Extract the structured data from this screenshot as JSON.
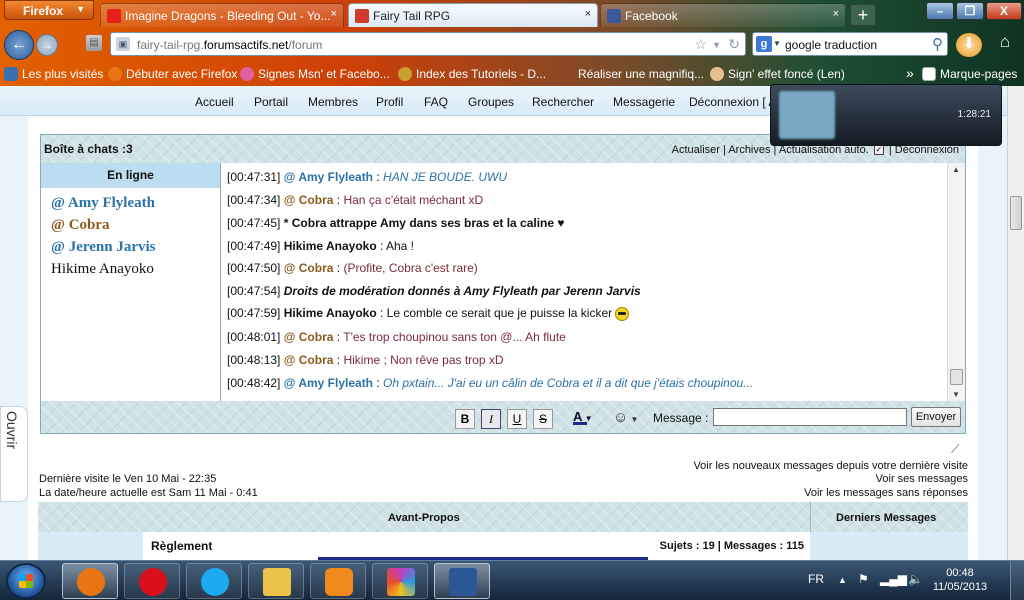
{
  "browser": {
    "menu_label": "Firefox",
    "tabs": [
      {
        "label": "Imagine Dragons - Bleeding Out - Yo...",
        "icon": "youtube-icon",
        "color": "#e62117"
      },
      {
        "label": "Fairy Tail RPG",
        "icon": "fairy-tail-icon",
        "color": "#d03a2a"
      },
      {
        "label": "Facebook",
        "icon": "facebook-icon",
        "color": "#3b5998"
      }
    ],
    "new_tab": "+",
    "window_buttons": {
      "minimize": "–",
      "maximize": "❐",
      "close": "X"
    },
    "url_host_prefix": "fairy-tail-rpg.",
    "url_host_bold": "forumsactifs.net",
    "url_path": "/forum",
    "search_value": "google traduction",
    "search_engine_icon": "google-icon",
    "bookmarks": [
      {
        "label": "Les plus visités",
        "icon": "star-icon",
        "color": "#3a6fb0"
      },
      {
        "label": "Débuter avec Firefox",
        "icon": "firefox-icon",
        "color": "#e87511"
      },
      {
        "label": "Signes Msn' et Facebo...",
        "icon": "flower-icon",
        "color": "#e35f9f"
      },
      {
        "label": "Index des Tutoriels - D...",
        "icon": "bird-icon",
        "color": "#c9a02f"
      },
      {
        "label": "Réaliser une magnifiq...",
        "icon": "blank-icon",
        "color": "#6f8d6a"
      },
      {
        "label": "Sign' effet foncé (Len)",
        "icon": "flower-icon",
        "color": "#e6c08c"
      }
    ],
    "bookmarks_more": "»",
    "bookmarks_menu": "Marque-pages"
  },
  "forum_nav": [
    "Accueil",
    "Portail",
    "Membres",
    "Profil",
    "FAQ",
    "Groupes",
    "Rechercher",
    "Messagerie",
    "Déconnexion [ Am"
  ],
  "chatbox": {
    "title": "Boîte à chats :3",
    "links": "Actualiser | Archives | Actualisation auto.",
    "links_end": "| Déconnexion",
    "online_header": "En ligne",
    "online_users": [
      {
        "name": "@ Amy Flyleath",
        "role": "mod"
      },
      {
        "name": "@ Cobra",
        "role": "adm"
      },
      {
        "name": "@ Jerenn Jarvis",
        "role": "mod"
      },
      {
        "name": "Hikime Anayoko",
        "role": "std"
      }
    ],
    "messages": [
      {
        "time": "[00:47:31]",
        "user": "@ Amy Flyleath",
        "role": "mod",
        "sep": " : ",
        "text": "HAN JE BOUDE. UWU",
        "kind": "mod"
      },
      {
        "time": "[00:47:34]",
        "user": "@ Cobra",
        "role": "adm",
        "sep": " : ",
        "text": "Han ça c'était méchant xD",
        "kind": "adm"
      },
      {
        "time": "[00:47:45]",
        "user": "",
        "role": "",
        "sep": "",
        "text": "* Cobra attrappe Amy dans ses bras et la caline ♥",
        "kind": "act"
      },
      {
        "time": "[00:47:49]",
        "user": "Hikime Anayoko",
        "role": "std",
        "sep": " : ",
        "text": "Aha !",
        "kind": "std"
      },
      {
        "time": "[00:47:50]",
        "user": "@ Cobra",
        "role": "adm",
        "sep": " : ",
        "text": "(Profite, Cobra c'est rare)",
        "kind": "adm"
      },
      {
        "time": "[00:47:54]",
        "user": "",
        "role": "",
        "sep": "",
        "text": "Droits de modération donnés à Amy Flyleath par Jerenn Jarvis",
        "kind": "sys"
      },
      {
        "time": "[00:47:59]",
        "user": "Hikime Anayoko",
        "role": "std",
        "sep": " : ",
        "text": "Le comble ce serait que je puisse la kicker",
        "kind": "std",
        "smiley": true
      },
      {
        "time": "[00:48:01]",
        "user": "@ Cobra",
        "role": "adm",
        "sep": " : ",
        "text": "T'es trop choupinou sans ton @... Ah flute",
        "kind": "adm"
      },
      {
        "time": "[00:48:13]",
        "user": "@ Cobra",
        "role": "adm",
        "sep": " : ",
        "text": "Hikime ; Non rêve pas trop xD",
        "kind": "adm"
      },
      {
        "time": "[00:48:42]",
        "user": "@ Amy Flyleath",
        "role": "mod",
        "sep": " : ",
        "text": "Oh pxtain... J'ai eu un câlin de Cobra et il a dit que j'étais choupinou...",
        "kind": "mod"
      }
    ],
    "toolbar": {
      "bold": "B",
      "italic": "I",
      "underline": "U",
      "strike": "S",
      "color": "A",
      "smiley": "☺"
    },
    "message_label": "Message :",
    "message_value": "",
    "send_label": "Envoyer"
  },
  "visit_info": {
    "last_visit": "Dernière visite le Ven 10 Mai - 22:35",
    "current": "La date/heure actuelle est Sam 11 Mai - 0:41"
  },
  "quick_links": [
    "Voir les nouveaux messages depuis votre dernière visite",
    "Voir ses messages",
    "Voir les messages sans réponses"
  ],
  "category": {
    "title": "Avant-Propos",
    "last_col": "Derniers Messages",
    "forum_name": "Règlement",
    "stats": "Sujets : 19 | Messages : 115"
  },
  "side_tab": "Ouvrir",
  "popup": {
    "title": "",
    "time": "1:28:21"
  },
  "taskbar": {
    "apps": [
      {
        "icon": "firefox-icon",
        "color": "#e87511",
        "active": true
      },
      {
        "icon": "opera-icon",
        "color": "#d9101c",
        "active": false
      },
      {
        "icon": "skype-icon",
        "color": "#1eaaf1",
        "active": false
      },
      {
        "icon": "explorer-icon",
        "color": "#e9c247",
        "active": false
      },
      {
        "icon": "media-player-icon",
        "color": "#f08a1c",
        "active": false
      },
      {
        "icon": "movie-studio-icon",
        "color": "#c23bbf",
        "active": false
      },
      {
        "icon": "word-icon",
        "color": "#2b5797",
        "active": true
      }
    ],
    "lang": "FR",
    "time": "00:48",
    "date": "11/05/2013"
  }
}
